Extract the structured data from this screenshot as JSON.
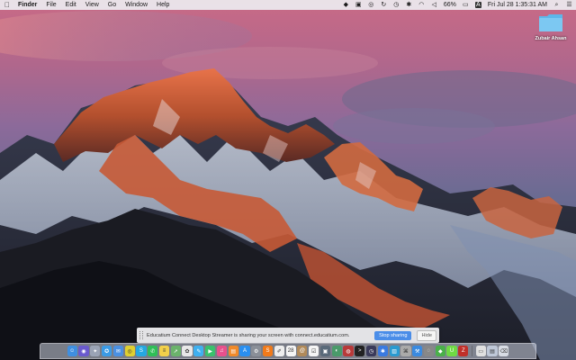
{
  "menubar": {
    "apple_icon": "apple-icon",
    "items": [
      {
        "label": "Finder",
        "bold": true
      },
      {
        "label": "File"
      },
      {
        "label": "Edit"
      },
      {
        "label": "View"
      },
      {
        "label": "Go"
      },
      {
        "label": "Window"
      },
      {
        "label": "Help"
      }
    ],
    "status": {
      "battery_percent": "66%",
      "input_source": "A",
      "datetime": "Fri Jul 28  1:35:31 AM"
    }
  },
  "desktop": {
    "folder_label": "Zubair Ahsan"
  },
  "share_bar": {
    "message": "Educatium Connect Desktop Streamer is sharing your screen with connect.educatium.com.",
    "stop_label": "Stop sharing",
    "hide_label": "Hide"
  },
  "dock": {
    "icons": [
      {
        "name": "finder-icon",
        "color": "#3f8fe0",
        "glyph": "☺"
      },
      {
        "name": "siri-icon",
        "color": "#6a5acd",
        "glyph": "◉"
      },
      {
        "name": "launchpad-icon",
        "color": "#9aa3b5",
        "glyph": "✦"
      },
      {
        "name": "safari-icon",
        "color": "#3b9be6",
        "glyph": "✪"
      },
      {
        "name": "mail-icon",
        "color": "#4a90e2",
        "glyph": "✉"
      },
      {
        "name": "chrome-icon",
        "color": "#e0d030",
        "glyph": "◎"
      },
      {
        "name": "skype-icon",
        "color": "#25a8e0",
        "glyph": "S"
      },
      {
        "name": "whatsapp-icon",
        "color": "#2fbe57",
        "glyph": "✆"
      },
      {
        "name": "notes-icon",
        "color": "#f2d04a",
        "glyph": "≡"
      },
      {
        "name": "maps-icon",
        "color": "#6bb36b",
        "glyph": "➚"
      },
      {
        "name": "photos-icon",
        "color": "#e8e8e8",
        "glyph": "✿"
      },
      {
        "name": "messages-icon",
        "color": "#3fb0f0",
        "glyph": "✎"
      },
      {
        "name": "facetime-icon",
        "color": "#39c16c",
        "glyph": "▶"
      },
      {
        "name": "itunes-icon",
        "color": "#e8508c",
        "glyph": "♫"
      },
      {
        "name": "ibooks-icon",
        "color": "#f08a2a",
        "glyph": "▤"
      },
      {
        "name": "appstore-icon",
        "color": "#2a8ff0",
        "glyph": "A"
      },
      {
        "name": "preferences-icon",
        "color": "#8a8f98",
        "glyph": "⚙"
      },
      {
        "name": "sublime-icon",
        "color": "#f07a1a",
        "glyph": "S"
      },
      {
        "name": "textedit-icon",
        "color": "#eeeeee",
        "glyph": "✐"
      },
      {
        "name": "calendar-icon",
        "color": "#f5f5f5",
        "glyph": "28"
      },
      {
        "name": "contacts-icon",
        "color": "#b08a5a",
        "glyph": "@"
      },
      {
        "name": "reminders-icon",
        "color": "#f5f5f5",
        "glyph": "☑"
      },
      {
        "name": "finder-window-icon",
        "color": "#5a6a7a",
        "glyph": "▣"
      },
      {
        "name": "screen-sharing-icon",
        "color": "#4a9a6a",
        "glyph": "◐"
      },
      {
        "name": "photo-booth-icon",
        "color": "#b83a3a",
        "glyph": "◍"
      },
      {
        "name": "terminal-icon",
        "color": "#222222",
        "glyph": ">"
      },
      {
        "name": "dashboard-icon",
        "color": "#3a3a5a",
        "glyph": "◷"
      },
      {
        "name": "bluetooth-file-icon",
        "color": "#3a7ae0",
        "glyph": "✱"
      },
      {
        "name": "activity-monitor-icon",
        "color": "#2a9ad0",
        "glyph": "▥"
      },
      {
        "name": "keychain-icon",
        "color": "#aaaaaa",
        "glyph": "⌘"
      },
      {
        "name": "xcode-icon",
        "color": "#3a8ae0",
        "glyph": "⚒"
      },
      {
        "name": "tunnelblick-icon",
        "color": "#888888",
        "glyph": "◌"
      },
      {
        "name": "android-studio-icon",
        "color": "#4ab04a",
        "glyph": "◆"
      },
      {
        "name": "upwork-icon",
        "color": "#6fda44",
        "glyph": "U"
      },
      {
        "name": "filezilla-icon",
        "color": "#c0302a",
        "glyph": "Z"
      }
    ],
    "right_icons": [
      {
        "name": "documents-stack-icon",
        "color": "#e0e0e0",
        "glyph": "▭"
      },
      {
        "name": "downloads-stack-icon",
        "color": "#bfc8d8",
        "glyph": "▤"
      },
      {
        "name": "trash-icon",
        "color": "#d8dce4",
        "glyph": "⌫"
      }
    ]
  }
}
